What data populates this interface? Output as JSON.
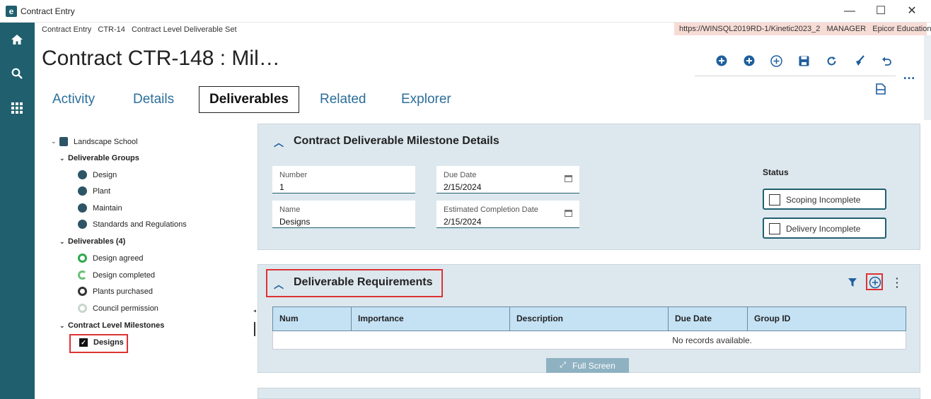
{
  "window": {
    "title": "Contract Entry",
    "minimize": "—",
    "maximize": "☐",
    "close": "✕"
  },
  "breadcrumb": [
    "Contract Entry",
    "CTR-14",
    "Contract Level Deliverable Set"
  ],
  "environment": {
    "url": "https://WINSQL2019RD-1/Kinetic2023_2",
    "role": "MANAGER",
    "company": "Epicor Education"
  },
  "page_title": "Contract CTR-148 : Mil…",
  "toolbar": {
    "icons": [
      "add-new-icon",
      "add-icon",
      "add-circle-icon",
      "save-icon",
      "refresh-icon",
      "clear-icon",
      "undo-icon"
    ],
    "more": "…"
  },
  "tabs": [
    "Activity",
    "Details",
    "Deliverables",
    "Related",
    "Explorer"
  ],
  "active_tab": "Deliverables",
  "tree": {
    "root": "Landscape School",
    "groups_label": "Deliverable Groups",
    "groups": [
      "Design",
      "Plant",
      "Maintain",
      "Standards and Regulations"
    ],
    "deliverables_label": "Deliverables (4)",
    "deliverables": [
      {
        "label": "Design agreed",
        "status": "complete"
      },
      {
        "label": "Design completed",
        "status": "partial"
      },
      {
        "label": "Plants purchased",
        "status": "dark"
      },
      {
        "label": "Council permission",
        "status": "pending"
      }
    ],
    "milestones_label": "Contract Level Milestones",
    "milestones": [
      "Designs"
    ]
  },
  "milestone_details": {
    "title": "Contract Deliverable Milestone Details",
    "number_label": "Number",
    "number_value": "1",
    "due_date_label": "Due Date",
    "due_date_value": "2/15/2024",
    "name_label": "Name",
    "name_value": "Designs",
    "est_completion_label": "Estimated Completion Date",
    "est_completion_value": "2/15/2024",
    "status_label": "Status",
    "scoping": "Scoping Incomplete",
    "delivery": "Delivery Incomplete"
  },
  "requirements": {
    "title": "Deliverable Requirements",
    "columns": [
      "Num",
      "Importance",
      "Description",
      "Due Date",
      "Group ID"
    ],
    "empty_text": "No records available.",
    "fullscreen": "Full Screen"
  },
  "colors": {
    "nav_bg": "#1f5f6e",
    "panel_bg": "#dde8ee",
    "grid_header": "#c5e2f5",
    "highlight": "#dd3333",
    "url_bg": "#f7dcd6"
  }
}
